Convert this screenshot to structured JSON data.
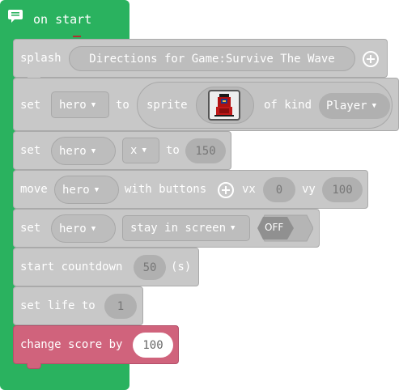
{
  "event": {
    "label": "on start",
    "comment_icon": "comment-icon"
  },
  "blocks": {
    "splash": {
      "keyword": "splash",
      "text": "Directions for Game:Survive The Wave",
      "add_icon": "plus-circle-icon"
    },
    "set_sprite": {
      "keyword": "set",
      "variable": "hero",
      "to": "to",
      "sprite": "sprite",
      "of_kind": "of kind",
      "kind": "Player",
      "sprite_icon": "hooded-hero-sprite-icon"
    },
    "set_x": {
      "keyword": "set",
      "variable": "hero",
      "property": "x",
      "to": "to",
      "value": "150"
    },
    "move": {
      "keyword": "move",
      "variable": "hero",
      "with_buttons": "with buttons",
      "vx_label": "vx",
      "vx": "0",
      "vy_label": "vy",
      "vy": "100",
      "add_icon": "plus-circle-icon"
    },
    "stay": {
      "keyword": "set",
      "variable": "hero",
      "flag": "stay in screen",
      "toggle": "OFF"
    },
    "countdown": {
      "label": "start countdown",
      "value": "50",
      "unit": "(s)"
    },
    "life": {
      "label": "set life to",
      "value": "1"
    },
    "score": {
      "label": "change score by",
      "value": "100"
    }
  },
  "colors": {
    "event": "#2ab25f",
    "block": "#c8c8c8",
    "score": "#d0637c"
  }
}
